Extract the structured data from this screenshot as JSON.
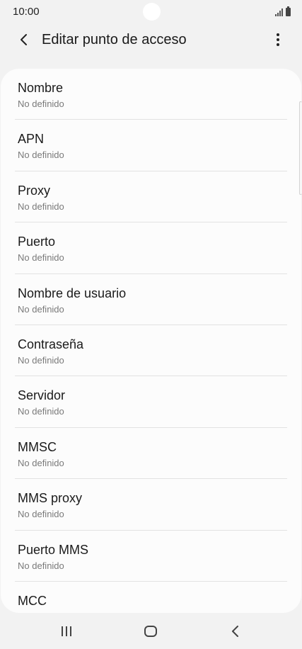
{
  "status_bar": {
    "time": "10:00"
  },
  "header": {
    "title": "Editar punto de acceso",
    "back_icon": "chevron-left-icon",
    "more_icon": "more-vertical-icon"
  },
  "settings": {
    "items": [
      {
        "label": "Nombre",
        "value": "No definido"
      },
      {
        "label": "APN",
        "value": "No definido"
      },
      {
        "label": "Proxy",
        "value": "No definido"
      },
      {
        "label": "Puerto",
        "value": "No definido"
      },
      {
        "label": "Nombre de usuario",
        "value": "No definido"
      },
      {
        "label": "Contraseña",
        "value": "No definido"
      },
      {
        "label": "Servidor",
        "value": "No definido"
      },
      {
        "label": "MMSC",
        "value": "No definido"
      },
      {
        "label": "MMS proxy",
        "value": "No definido"
      },
      {
        "label": "Puerto MMS",
        "value": "No definido"
      },
      {
        "label": "MCC",
        "value": ""
      }
    ]
  },
  "navigation": {
    "recents_icon": "recent-apps-icon",
    "home_icon": "home-icon",
    "back_icon": "back-chevron-icon"
  },
  "colors": {
    "background": "#f2f2f2",
    "card": "#fcfcfc",
    "primary_text": "#1a1a1a",
    "secondary_text": "#7a7a7a",
    "divider": "#e2e2e2"
  }
}
